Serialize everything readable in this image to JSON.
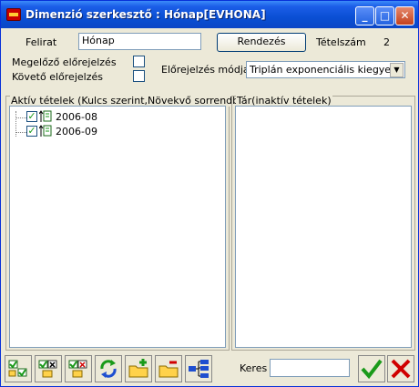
{
  "window": {
    "title": "Dimenzió szerkesztő : Hónap[EVHONA]",
    "minimize_glyph": "_",
    "maximize_glyph": "□",
    "close_glyph": "✕"
  },
  "form": {
    "caption_label": "Felirat",
    "caption_value": "Hónap",
    "sort_button": "Rendezés",
    "count_label": "Tételszám",
    "count_value": "2",
    "prev_forecast_label": "Megelőző előrejelzés",
    "next_forecast_label": "Követő előrejelzés",
    "forecast_mode_label": "Előrejelzés módja",
    "forecast_mode_value": "Triplán exponenciális kiegyenlíté"
  },
  "active_items": {
    "caption": "Aktív tételek (Kulcs szerint,Növekvő sorrendben)",
    "items": [
      {
        "label": "2006-08",
        "checked": true
      },
      {
        "label": "2006-09",
        "checked": true
      }
    ]
  },
  "inactive_items": {
    "caption": "Tár(inaktív tételek)"
  },
  "toolbar": {
    "icons": [
      "select-all-icon",
      "deselect-all-icon",
      "remove-checked-icon",
      "refresh-icon",
      "add-folder-icon",
      "remove-folder-icon",
      "hierarchy-icon"
    ]
  },
  "search": {
    "label": "Keres",
    "value": ""
  },
  "colors": {
    "title_bar": "#0a4fd4",
    "ok": "#1a9a1a",
    "cancel": "#d00000"
  }
}
